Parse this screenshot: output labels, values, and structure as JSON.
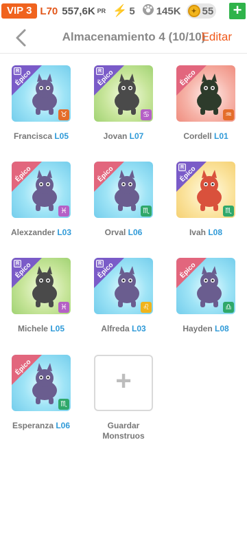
{
  "status": {
    "vip": "VIP 3",
    "level": "L70",
    "pr_value": "557,6K",
    "pr_unit": "PR",
    "energy": "5",
    "food": "145K",
    "coins": "55",
    "add": "+"
  },
  "header": {
    "title": "Almacenamiento 4 (10/10)",
    "edit": "Editar"
  },
  "rarity": "Épico",
  "rank_badge": "R",
  "monsters": [
    {
      "name": "Francisca",
      "level": "L05",
      "bg": "blue",
      "rank": true,
      "zodiac": "♉",
      "zodiac_color": "#e46d2a",
      "icon": "creature-icon"
    },
    {
      "name": "Jovan",
      "level": "L07",
      "bg": "green",
      "rank": true,
      "zodiac": "♋",
      "zodiac_color": "#b560c6",
      "icon": "creature-icon"
    },
    {
      "name": "Cordell",
      "level": "L01",
      "bg": "red",
      "rank": false,
      "zodiac": "♒",
      "zodiac_color": "#e46d2a",
      "icon": "creature-icon"
    },
    {
      "name": "Alexzander",
      "level": "L03",
      "bg": "blue",
      "rank": false,
      "zodiac": "♓",
      "zodiac_color": "#b560c6",
      "icon": "creature-icon"
    },
    {
      "name": "Orval",
      "level": "L06",
      "bg": "blue",
      "rank": false,
      "zodiac": "♏",
      "zodiac_color": "#2fa86a",
      "icon": "creature-icon"
    },
    {
      "name": "Ivah",
      "level": "L08",
      "bg": "yellow",
      "rank": true,
      "zodiac": "♏",
      "zodiac_color": "#2fa86a",
      "icon": "creature-icon"
    },
    {
      "name": "Michele",
      "level": "L05",
      "bg": "green",
      "rank": true,
      "zodiac": "♓",
      "zodiac_color": "#b560c6",
      "icon": "creature-icon"
    },
    {
      "name": "Alfreda",
      "level": "L03",
      "bg": "blue",
      "rank": true,
      "zodiac": "♌",
      "zodiac_color": "#f0b41c",
      "icon": "creature-icon"
    },
    {
      "name": "Hayden",
      "level": "L08",
      "bg": "blue",
      "rank": false,
      "zodiac": "♎",
      "zodiac_color": "#2fa86a",
      "icon": "creature-icon"
    },
    {
      "name": "Esperanza",
      "level": "L06",
      "bg": "blue",
      "rank": false,
      "zodiac": "♏",
      "zodiac_color": "#2fa86a",
      "icon": "creature-icon"
    }
  ],
  "add_slot": {
    "plus": "+",
    "label_line1": "Guardar",
    "label_line2": "Monstruos"
  }
}
